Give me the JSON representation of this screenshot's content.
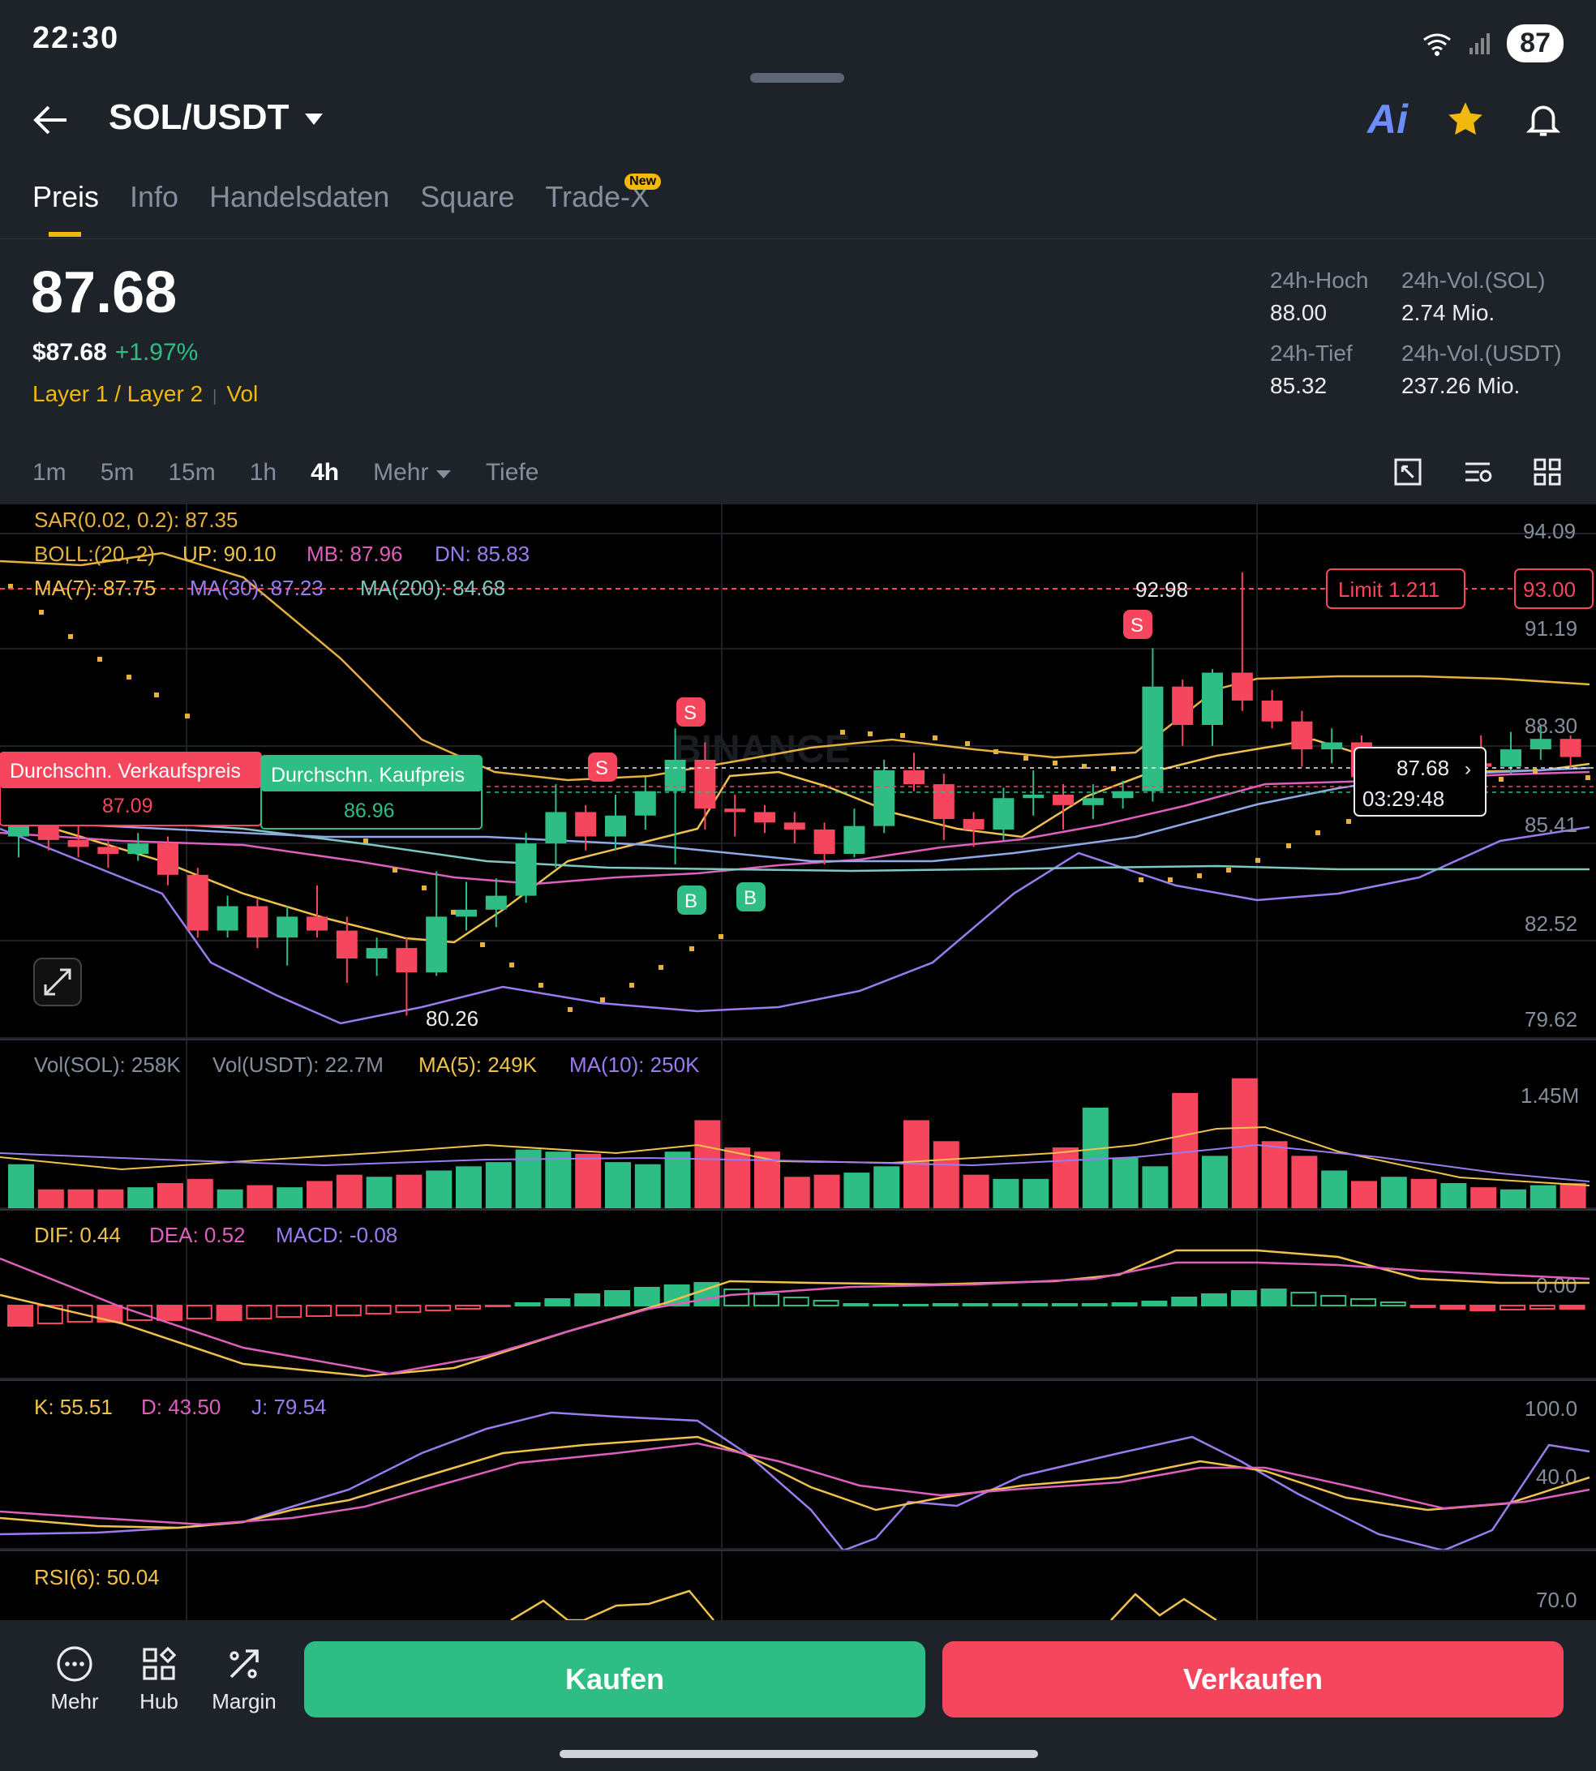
{
  "status": {
    "time": "22:30",
    "battery": "87"
  },
  "header": {
    "pair": "SOL/USDT",
    "ai_label": "Ai"
  },
  "tabs": [
    {
      "label": "Preis",
      "active": true
    },
    {
      "label": "Info"
    },
    {
      "label": "Handelsdaten"
    },
    {
      "label": "Square"
    },
    {
      "label": "Trade-X",
      "badge": "New"
    }
  ],
  "ticker": {
    "price": "87.68",
    "usd_price": "$87.68",
    "change": "+1.97%",
    "tag1": "Layer 1 / Layer 2",
    "tag2": "Vol"
  },
  "stats": [
    {
      "label": "24h-Hoch",
      "value": "88.00"
    },
    {
      "label": "24h-Vol.(SOL)",
      "value": "2.74 Mio."
    },
    {
      "label": "24h-Tief",
      "value": "85.32"
    },
    {
      "label": "24h-Vol.(USDT)",
      "value": "237.26 Mio."
    }
  ],
  "timeframes": [
    "1m",
    "5m",
    "15m",
    "1h",
    "4h",
    "Mehr",
    "Tiefe"
  ],
  "active_timeframe": "4h",
  "indicators": {
    "sar": "SAR(0.02, 0.2): 87.35",
    "boll_label": "BOLL:(20, 2)",
    "boll_up": "UP: 90.10",
    "boll_mb": "MB: 87.96",
    "boll_dn": "DN: 85.83",
    "ma7": "MA(7): 87.75",
    "ma30": "MA(30): 87.23",
    "ma200": "MA(200): 84.68",
    "vol_sol": "Vol(SOL): 258K",
    "vol_usdt": "Vol(USDT): 22.7M",
    "vol_ma5": "MA(5): 249K",
    "vol_ma10": "MA(10): 250K",
    "dif": "DIF: 0.44",
    "dea": "DEA: 0.52",
    "macd": "MACD: -0.08",
    "k": "K: 55.51",
    "d": "D: 43.50",
    "j": "J: 79.54",
    "rsi": "RSI(6): 50.04"
  },
  "price_axis": [
    "94.09",
    "91.19",
    "88.30",
    "85.41",
    "82.52",
    "79.62"
  ],
  "vol_axis": [
    "1.45M"
  ],
  "macd_axis": [
    "0.00"
  ],
  "kdj_axis": [
    "100.0",
    "40.0"
  ],
  "rsi_axis": [
    "70.0"
  ],
  "markers": {
    "high": "92.98",
    "low": "80.26",
    "limit": "Limit 1.211",
    "limit_price": "93.00",
    "current": "87.68",
    "countdown": "03:29:48",
    "avg_sell_label": "Durchschn. Verkaufspreis",
    "avg_sell_value": "87.09",
    "avg_buy_label": "Durchschn. Kaufpreis",
    "avg_buy_value": "86.96",
    "buy_marker": "B",
    "sell_marker": "S",
    "watermark": "BINANCE"
  },
  "colors": {
    "up": "#2ebd85",
    "down": "#f6465d",
    "accent": "#f0b90b",
    "bg": "#1e2329"
  },
  "chart_data": {
    "type": "candlestick",
    "candles": [
      {
        "o": 85.4,
        "c": 85.9,
        "h": 86.3,
        "l": 84.8
      },
      {
        "o": 85.9,
        "c": 85.3,
        "h": 86.1,
        "l": 85.0
      },
      {
        "o": 85.3,
        "c": 85.1,
        "h": 85.7,
        "l": 84.8
      },
      {
        "o": 85.1,
        "c": 84.9,
        "h": 85.3,
        "l": 84.5
      },
      {
        "o": 84.9,
        "c": 85.2,
        "h": 85.5,
        "l": 84.7
      },
      {
        "o": 85.2,
        "c": 84.3,
        "h": 85.4,
        "l": 84.0
      },
      {
        "o": 84.3,
        "c": 82.7,
        "h": 84.5,
        "l": 82.5
      },
      {
        "o": 82.7,
        "c": 83.4,
        "h": 83.7,
        "l": 82.5
      },
      {
        "o": 83.4,
        "c": 82.5,
        "h": 83.6,
        "l": 82.2
      },
      {
        "o": 82.5,
        "c": 83.1,
        "h": 83.4,
        "l": 81.7
      },
      {
        "o": 83.1,
        "c": 82.7,
        "h": 84.0,
        "l": 82.5
      },
      {
        "o": 82.7,
        "c": 81.9,
        "h": 83.1,
        "l": 81.2
      },
      {
        "o": 81.9,
        "c": 82.2,
        "h": 82.5,
        "l": 81.4
      },
      {
        "o": 82.2,
        "c": 81.5,
        "h": 82.5,
        "l": 80.26
      },
      {
        "o": 81.5,
        "c": 83.1,
        "h": 84.4,
        "l": 81.4
      },
      {
        "o": 83.1,
        "c": 83.3,
        "h": 84.1,
        "l": 82.7
      },
      {
        "o": 83.3,
        "c": 83.7,
        "h": 84.2,
        "l": 82.8
      },
      {
        "o": 83.7,
        "c": 85.2,
        "h": 85.5,
        "l": 83.5
      },
      {
        "o": 85.2,
        "c": 86.1,
        "h": 86.9,
        "l": 84.5
      },
      {
        "o": 86.1,
        "c": 85.4,
        "h": 86.3,
        "l": 85.0
      },
      {
        "o": 85.4,
        "c": 86.0,
        "h": 86.6,
        "l": 85.0
      },
      {
        "o": 86.0,
        "c": 86.7,
        "h": 87.1,
        "l": 85.6
      },
      {
        "o": 86.7,
        "c": 87.6,
        "h": 88.5,
        "l": 84.6
      },
      {
        "o": 87.6,
        "c": 86.2,
        "h": 88.1,
        "l": 85.6
      },
      {
        "o": 86.2,
        "c": 86.1,
        "h": 86.6,
        "l": 85.4
      },
      {
        "o": 86.1,
        "c": 85.8,
        "h": 86.3,
        "l": 85.5
      },
      {
        "o": 85.8,
        "c": 85.6,
        "h": 86.1,
        "l": 85.2
      },
      {
        "o": 85.6,
        "c": 84.9,
        "h": 85.8,
        "l": 84.6
      },
      {
        "o": 84.9,
        "c": 85.7,
        "h": 86.2,
        "l": 84.8
      },
      {
        "o": 85.7,
        "c": 87.3,
        "h": 87.6,
        "l": 85.5
      },
      {
        "o": 87.3,
        "c": 86.9,
        "h": 87.8,
        "l": 86.7
      },
      {
        "o": 86.9,
        "c": 85.9,
        "h": 87.2,
        "l": 85.3
      },
      {
        "o": 85.9,
        "c": 85.6,
        "h": 86.1,
        "l": 85.1
      },
      {
        "o": 85.6,
        "c": 86.5,
        "h": 86.8,
        "l": 85.3
      },
      {
        "o": 86.5,
        "c": 86.6,
        "h": 87.3,
        "l": 86.0
      },
      {
        "o": 86.6,
        "c": 86.3,
        "h": 86.9,
        "l": 85.6
      },
      {
        "o": 86.3,
        "c": 86.5,
        "h": 86.9,
        "l": 85.9
      },
      {
        "o": 86.5,
        "c": 86.7,
        "h": 87.0,
        "l": 86.2
      },
      {
        "o": 86.7,
        "c": 89.7,
        "h": 90.8,
        "l": 86.4
      },
      {
        "o": 89.7,
        "c": 88.6,
        "h": 89.9,
        "l": 88.0
      },
      {
        "o": 88.6,
        "c": 90.1,
        "h": 90.2,
        "l": 88.0
      },
      {
        "o": 90.1,
        "c": 89.3,
        "h": 92.98,
        "l": 89.0
      },
      {
        "o": 89.3,
        "c": 88.7,
        "h": 89.6,
        "l": 88.5
      },
      {
        "o": 88.7,
        "c": 87.9,
        "h": 89.0,
        "l": 87.4
      },
      {
        "o": 87.9,
        "c": 88.1,
        "h": 88.5,
        "l": 87.5
      },
      {
        "o": 88.1,
        "c": 87.1,
        "h": 88.3,
        "l": 86.7
      },
      {
        "o": 87.1,
        "c": 87.4,
        "h": 87.8,
        "l": 86.9
      },
      {
        "o": 87.4,
        "c": 87.3,
        "h": 87.9,
        "l": 87.0
      },
      {
        "o": 87.3,
        "c": 87.5,
        "h": 87.9,
        "l": 87.1
      },
      {
        "o": 87.5,
        "c": 87.4,
        "h": 88.3,
        "l": 87.2
      },
      {
        "o": 87.4,
        "c": 87.9,
        "h": 88.4,
        "l": 87.2
      },
      {
        "o": 87.9,
        "c": 88.2,
        "h": 88.6,
        "l": 87.6
      },
      {
        "o": 88.2,
        "c": 87.68,
        "h": 88.3,
        "l": 87.4
      }
    ],
    "volume": [
      210,
      90,
      90,
      90,
      100,
      120,
      140,
      90,
      110,
      100,
      130,
      160,
      150,
      160,
      180,
      200,
      220,
      280,
      270,
      260,
      220,
      210,
      270,
      420,
      290,
      270,
      150,
      160,
      170,
      200,
      420,
      320,
      160,
      140,
      140,
      290,
      480,
      240,
      200,
      550,
      250,
      620,
      320,
      250,
      180,
      130,
      150,
      140,
      120,
      100,
      90,
      110,
      120
    ],
    "ylim": [
      79.62,
      94.09
    ]
  }
}
